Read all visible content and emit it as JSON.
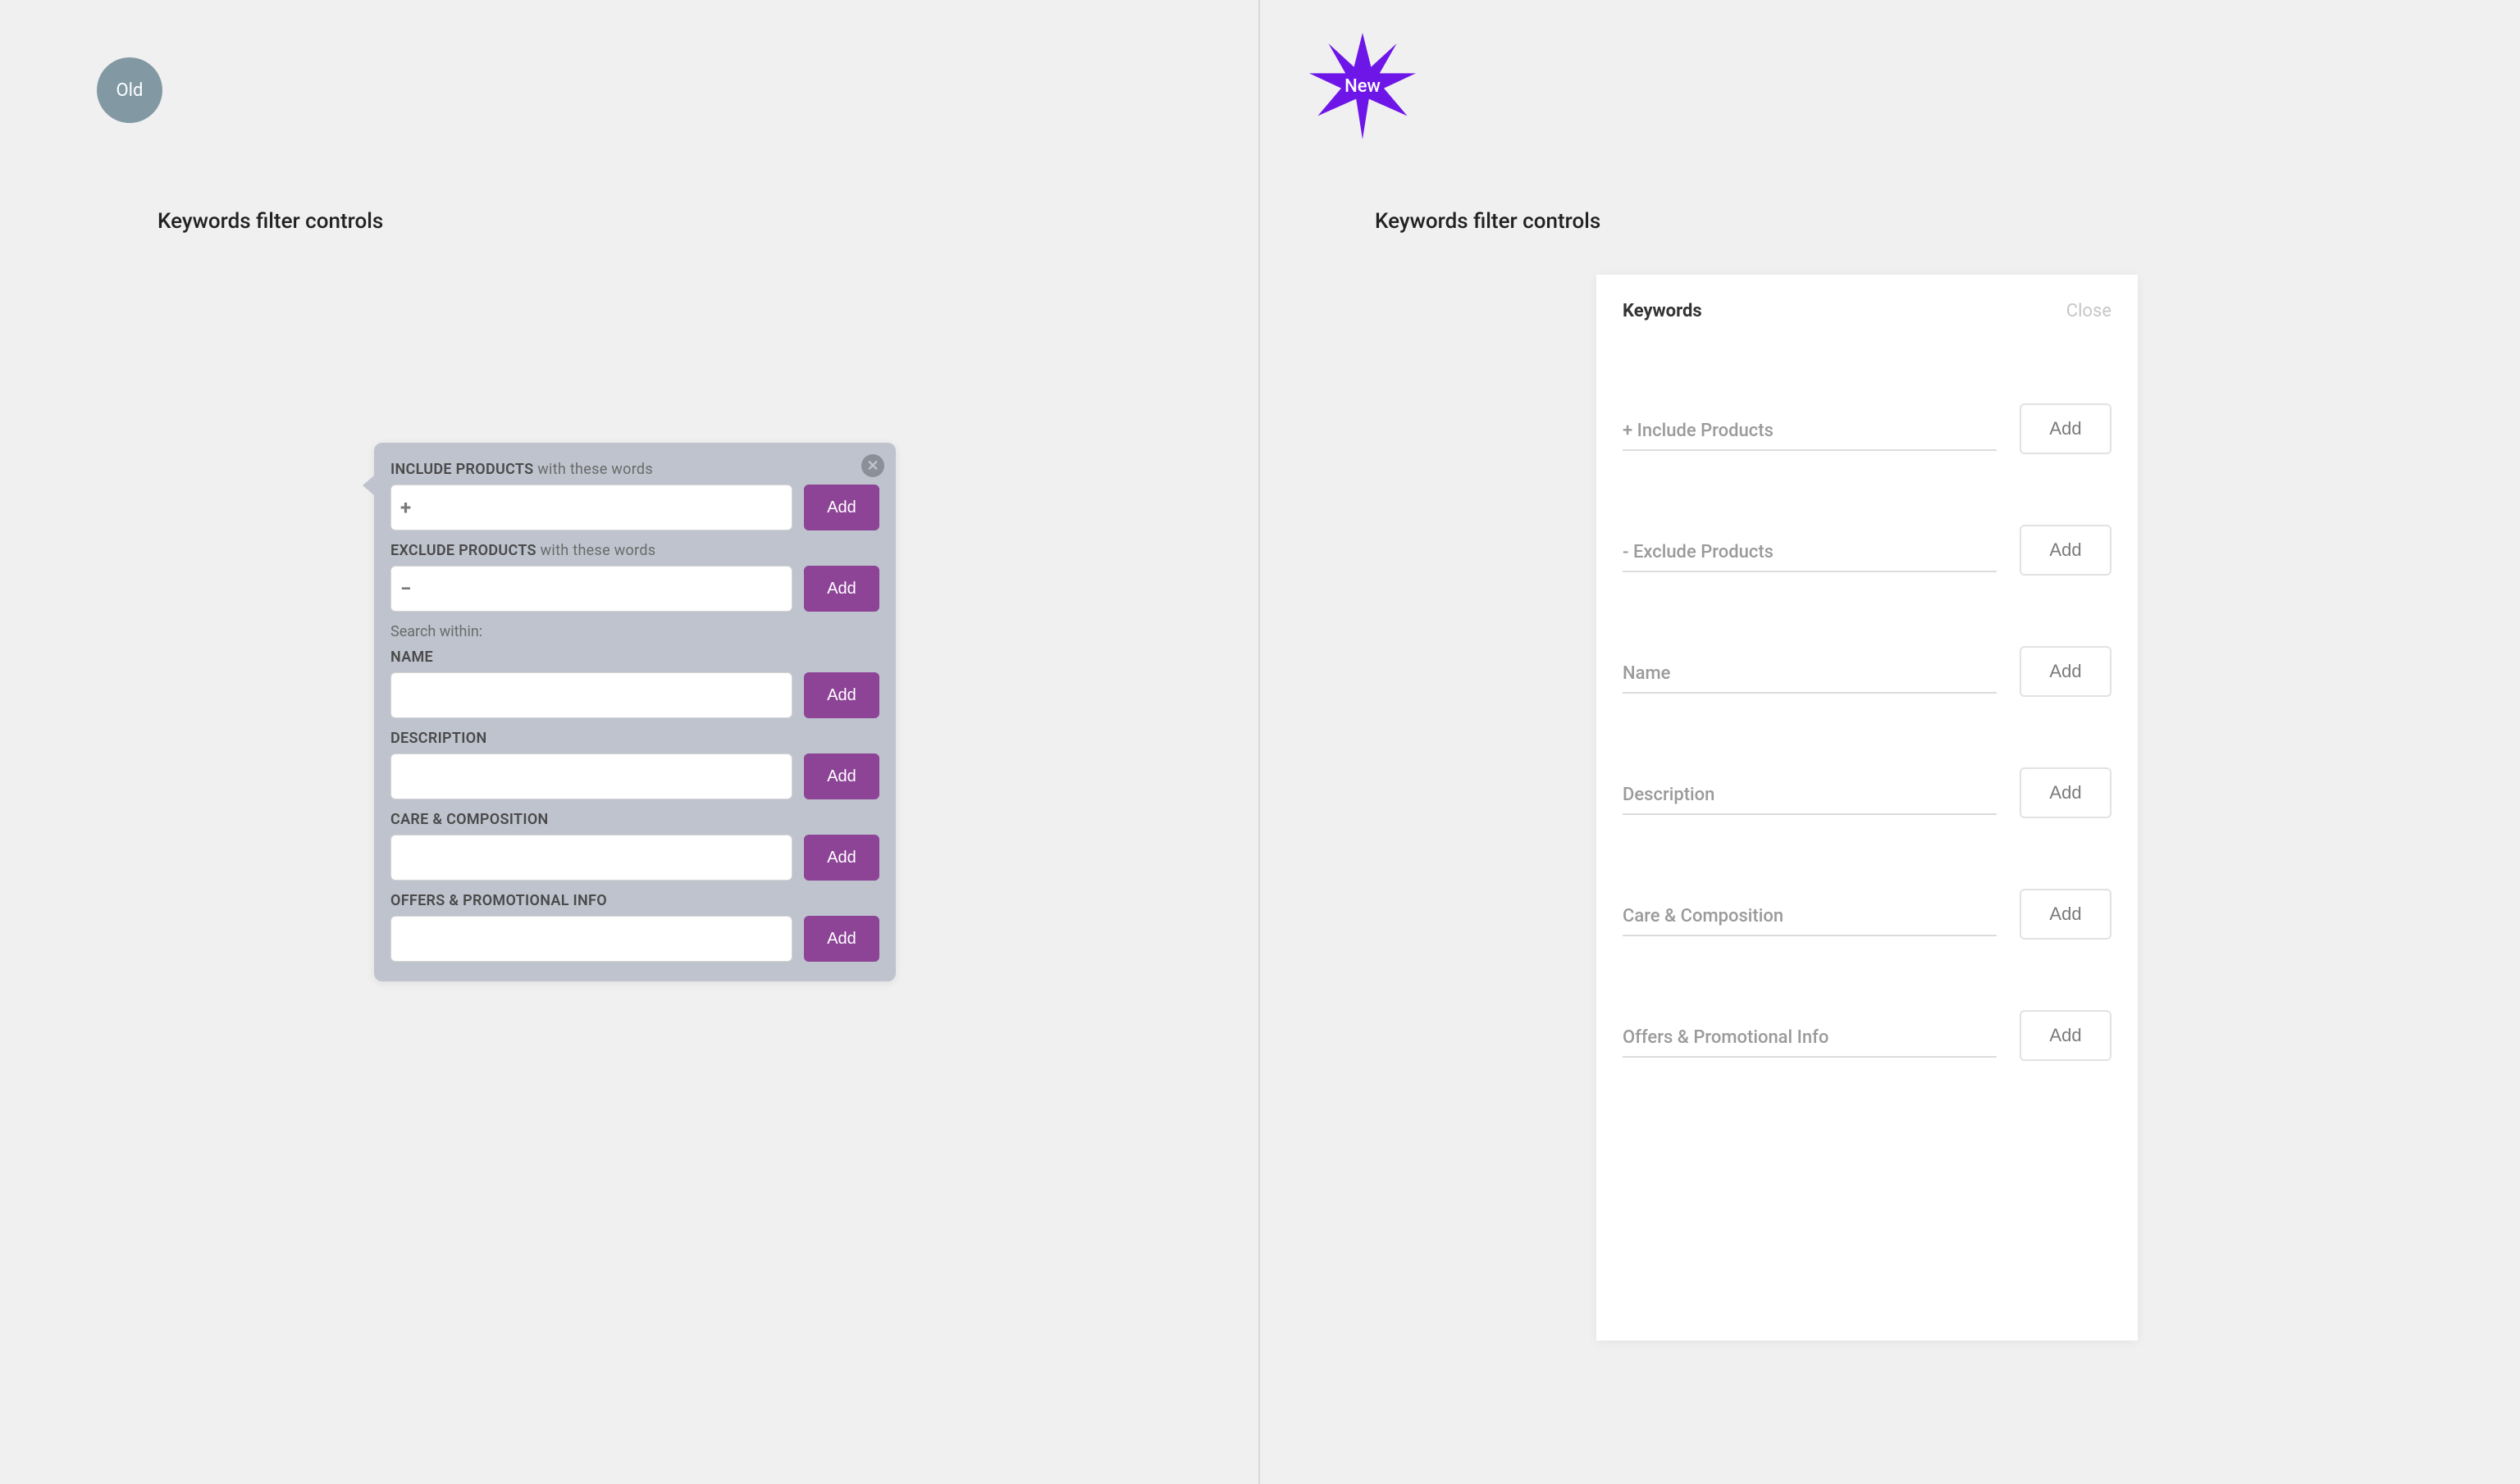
{
  "badges": {
    "old": "Old",
    "new": "New"
  },
  "section_title": "Keywords filter controls",
  "old": {
    "include": {
      "label_bold": "INCLUDE PRODUCTS",
      "label_thin": "with these words",
      "icon": "+",
      "add": "Add"
    },
    "exclude": {
      "label_bold": "EXCLUDE PRODUCTS",
      "label_thin": "with these words",
      "icon": "−",
      "add": "Add"
    },
    "search_within": "Search within:",
    "fields": [
      {
        "label": "NAME",
        "add": "Add"
      },
      {
        "label": "DESCRIPTION",
        "add": "Add"
      },
      {
        "label": "CARE & COMPOSITION",
        "add": "Add"
      },
      {
        "label": "OFFERS & PROMOTIONAL INFO",
        "add": "Add"
      }
    ]
  },
  "new": {
    "header_title": "Keywords",
    "close": "Close",
    "fields": [
      {
        "label": "+ Include Products",
        "add": "Add"
      },
      {
        "label": "- Exclude Products",
        "add": "Add"
      },
      {
        "label": "Name",
        "add": "Add"
      },
      {
        "label": "Description",
        "add": "Add"
      },
      {
        "label": "Care & Composition",
        "add": "Add"
      },
      {
        "label": "Offers & Promotional Info",
        "add": "Add"
      }
    ]
  }
}
